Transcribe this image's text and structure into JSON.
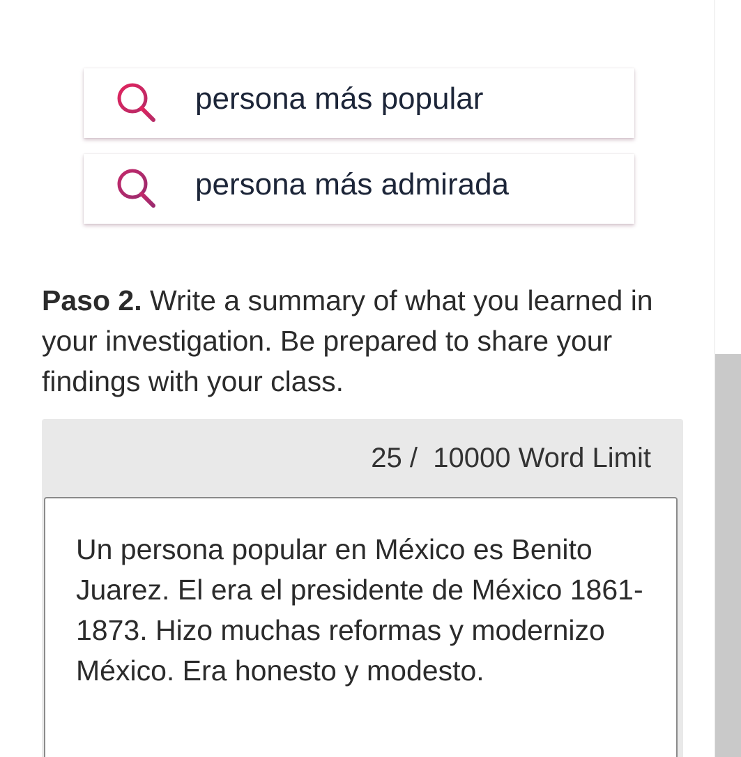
{
  "search_suggestions": [
    {
      "label": "persona más popular",
      "icon": "search-icon"
    },
    {
      "label": "persona más admirada",
      "icon": "search-icon"
    }
  ],
  "instructions": {
    "step_label": "Paso 2.",
    "text": "Write a summary of what you learned in your investigation. Be prepared to share your findings with your class."
  },
  "word_counter": {
    "count": "25",
    "separator": "/",
    "limit_text": "10000 Word Limit"
  },
  "editor": {
    "value": "Un persona popular en México es Benito Juarez. El era el presidente de México 1861-1873. Hizo muchas reformas y modernizo México. Era honesto y modesto."
  },
  "colors": {
    "icon_gradient_start": "#e0245e",
    "icon_gradient_end": "#9b2a6e",
    "label_text": "#1c2538",
    "panel_bg": "#e9e9e9"
  }
}
